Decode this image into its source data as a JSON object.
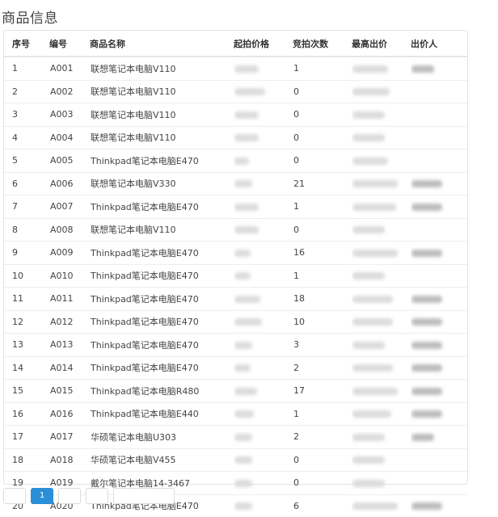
{
  "page_title": "商品信息",
  "columns": [
    "序号",
    "编号",
    "商品名称",
    "起拍价格",
    "竞拍次数",
    "最高出价",
    "出价人"
  ],
  "rows": [
    {
      "no": "1",
      "code": "A001",
      "name": "联想笔记本电脑V110",
      "bids": "1"
    },
    {
      "no": "2",
      "code": "A002",
      "name": "联想笔记本电脑V110",
      "bids": "0"
    },
    {
      "no": "3",
      "code": "A003",
      "name": "联想笔记本电脑V110",
      "bids": "0"
    },
    {
      "no": "4",
      "code": "A004",
      "name": "联想笔记本电脑V110",
      "bids": "0"
    },
    {
      "no": "5",
      "code": "A005",
      "name": "Thinkpad笔记本电脑E470",
      "bids": "0"
    },
    {
      "no": "6",
      "code": "A006",
      "name": "联想笔记本电脑V330",
      "bids": "21"
    },
    {
      "no": "7",
      "code": "A007",
      "name": "Thinkpad笔记本电脑E470",
      "bids": "1"
    },
    {
      "no": "8",
      "code": "A008",
      "name": "联想笔记本电脑V110",
      "bids": "0"
    },
    {
      "no": "9",
      "code": "A009",
      "name": "Thinkpad笔记本电脑E470",
      "bids": "16"
    },
    {
      "no": "10",
      "code": "A010",
      "name": "Thinkpad笔记本电脑E470",
      "bids": "1"
    },
    {
      "no": "11",
      "code": "A011",
      "name": "Thinkpad笔记本电脑E470",
      "bids": "18"
    },
    {
      "no": "12",
      "code": "A012",
      "name": "Thinkpad笔记本电脑E470",
      "bids": "10"
    },
    {
      "no": "13",
      "code": "A013",
      "name": "Thinkpad笔记本电脑E470",
      "bids": "3"
    },
    {
      "no": "14",
      "code": "A014",
      "name": "Thinkpad笔记本电脑E470",
      "bids": "2"
    },
    {
      "no": "15",
      "code": "A015",
      "name": "Thinkpad笔记本电脑R480",
      "bids": "17"
    },
    {
      "no": "16",
      "code": "A016",
      "name": "Thinkpad笔记本电脑E440",
      "bids": "1"
    },
    {
      "no": "17",
      "code": "A017",
      "name": "华硕笔记本电脑U303",
      "bids": "2"
    },
    {
      "no": "18",
      "code": "A018",
      "name": "华硕笔记本电脑V455",
      "bids": "0"
    },
    {
      "no": "19",
      "code": "A019",
      "name": "戴尔笔记本电脑14-3467",
      "bids": "0"
    },
    {
      "no": "20",
      "code": "A020",
      "name": "Thinkpad笔记本电脑E470",
      "bids": "6"
    }
  ],
  "pagination": {
    "current": "1"
  }
}
